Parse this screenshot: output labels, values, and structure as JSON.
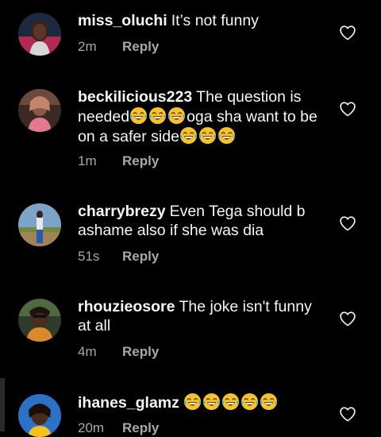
{
  "comments": [
    {
      "username": "miss_oluchi",
      "text": "It’s not funny",
      "time": "2m",
      "reply_label": "Reply",
      "avatar_icon": "avatar-photo-woman"
    },
    {
      "username": "beckilicious223",
      "text_part1": "The question is needed",
      "text_part2": "oga sha want to be on a safer side",
      "time": "1m",
      "reply_label": "Reply",
      "avatar_icon": "avatar-photo-woman"
    },
    {
      "username": "charrybrezy",
      "text": "Even Tega should b ashame also if she was dia",
      "time": "51s",
      "reply_label": "Reply",
      "avatar_icon": "avatar-photo-outdoor"
    },
    {
      "username": "rhouzieosore",
      "text": "The joke isn't funny at all",
      "time": "4m",
      "reply_label": "Reply",
      "avatar_icon": "avatar-photo-woman"
    },
    {
      "username": "ihanes_glamz",
      "text": "",
      "time": "20m",
      "reply_label": "Reply",
      "avatar_icon": "avatar-photo-woman"
    }
  ],
  "icons": {
    "like": "heart-outline-icon",
    "emoji": "face-with-tears-of-joy-emoji"
  },
  "colors": {
    "background": "#000000",
    "text": "#f5f5f5",
    "meta": "#a8a8a8"
  }
}
